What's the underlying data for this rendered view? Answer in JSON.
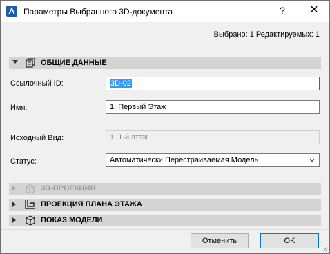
{
  "window": {
    "title": "Параметры Выбранного 3D-документа",
    "help": "?",
    "close": "✕"
  },
  "selected_info": "Выбрано: 1 Редактируемых: 1",
  "sections": {
    "general": {
      "label": "ОБЩИЕ ДАННЫЕ",
      "expanded": true
    },
    "projection3d": {
      "label": "3D-ПРОЕКЦИЯ",
      "enabled": false
    },
    "floor_plan": {
      "label": "ПРОЕКЦИЯ ПЛАНА ЭТАЖА"
    },
    "model_display": {
      "label": "ПОКАЗ МОДЕЛИ"
    }
  },
  "fields": {
    "ref_id": {
      "label": "Ссылочный ID:",
      "value": "3D-02"
    },
    "name": {
      "label": "Имя:",
      "value": "1. Первый Этаж"
    },
    "source_view": {
      "label": "Исходный Вид:",
      "value": "1. 1-й этаж"
    },
    "status": {
      "label": "Статус:",
      "value": "Автоматически Перестраиваемая Модель"
    }
  },
  "buttons": {
    "cancel": "Отменить",
    "ok": "OK"
  },
  "colors": {
    "accent": "#0078d7",
    "section_bg": "#d4d4d4",
    "selection": "#3399ff"
  }
}
